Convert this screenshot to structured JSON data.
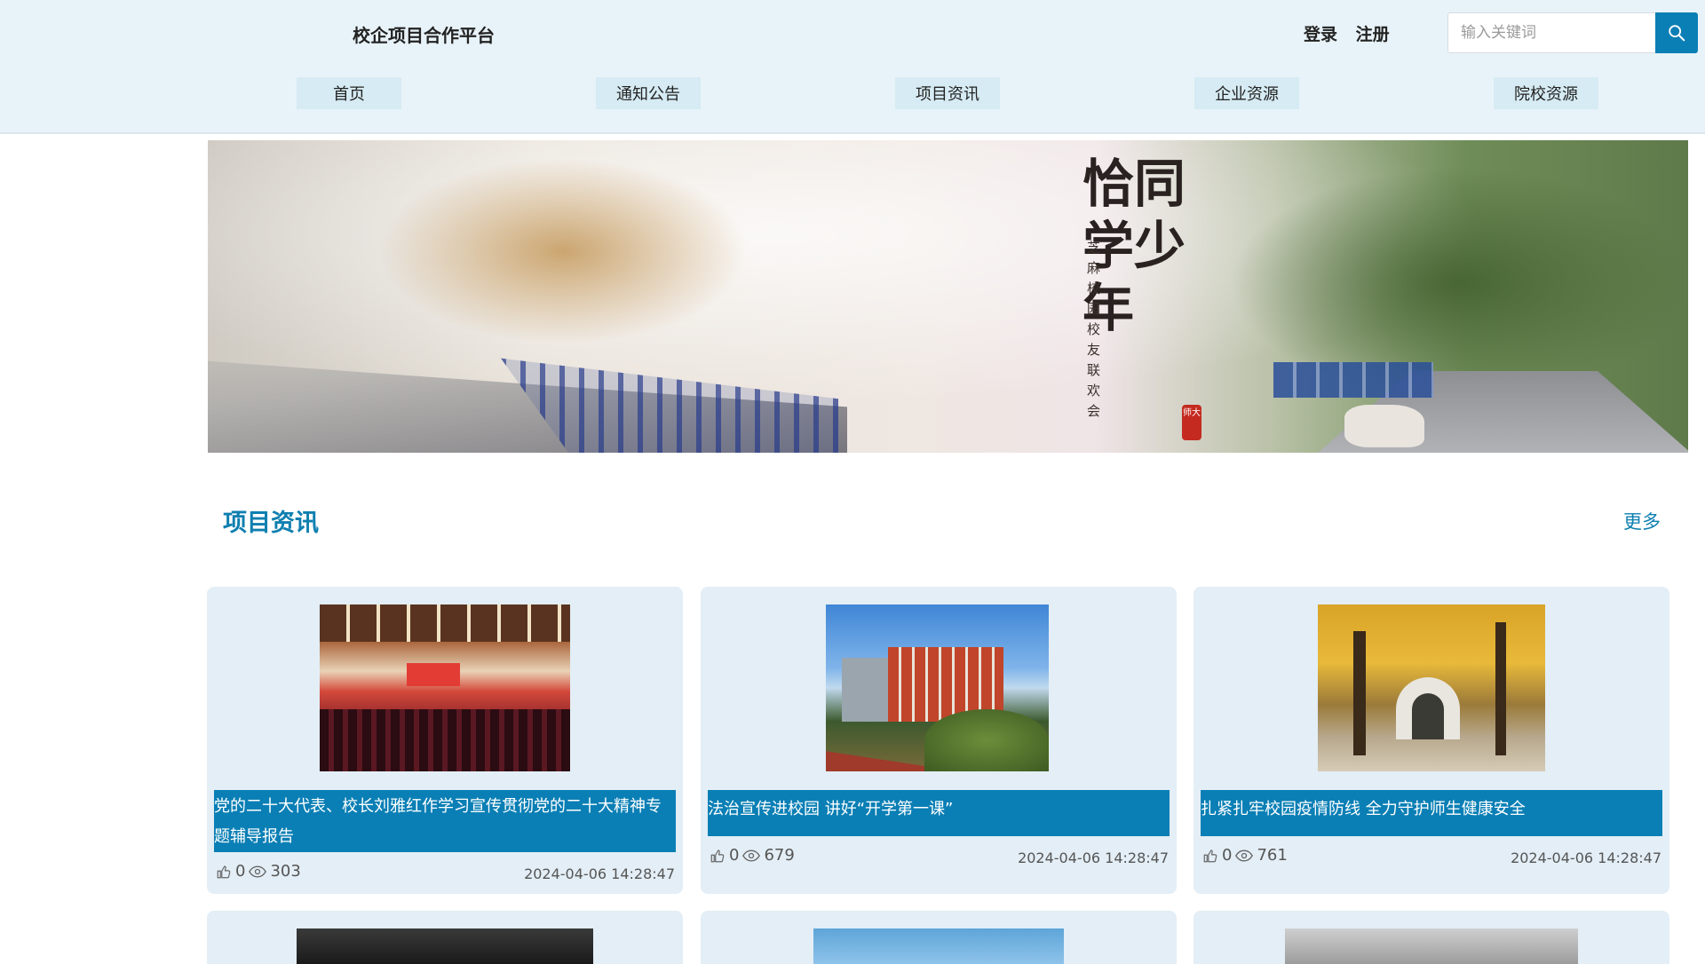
{
  "header": {
    "site_title": "校企项目合作平台",
    "login": "登录",
    "register": "注册",
    "search_placeholder": "输入关键词",
    "search_icon": "search-icon"
  },
  "nav": {
    "items": [
      {
        "label": "首页"
      },
      {
        "label": "通知公告"
      },
      {
        "label": "项目资讯"
      },
      {
        "label": "企业资源"
      },
      {
        "label": "院校资源"
      }
    ]
  },
  "banner": {
    "calligraphy_title": "恰同学少年",
    "calligraphy_sub": "芝麻校园校友联欢会",
    "seal": "师大"
  },
  "section": {
    "title": "项目资讯",
    "more": "更多"
  },
  "cards": [
    {
      "title": "党的二十大代表、校长刘雅红作学习宣传贯彻党的二十大精神专题辅导报告",
      "likes": "0",
      "views": "303",
      "date": "2024-04-06 14:28:47"
    },
    {
      "title": "法治宣传进校园 讲好“开学第一课”",
      "likes": "0",
      "views": "679",
      "date": "2024-04-06 14:28:47"
    },
    {
      "title": "扎紧扎牢校园疫情防线 全力守护师生健康安全",
      "likes": "0",
      "views": "761",
      "date": "2024-04-06 14:28:47"
    }
  ],
  "colors": {
    "accent": "#0a7fb5",
    "header_bg": "#e8f3f9",
    "card_bg": "#e3eef6",
    "nav_bg": "#d6ebf3"
  }
}
